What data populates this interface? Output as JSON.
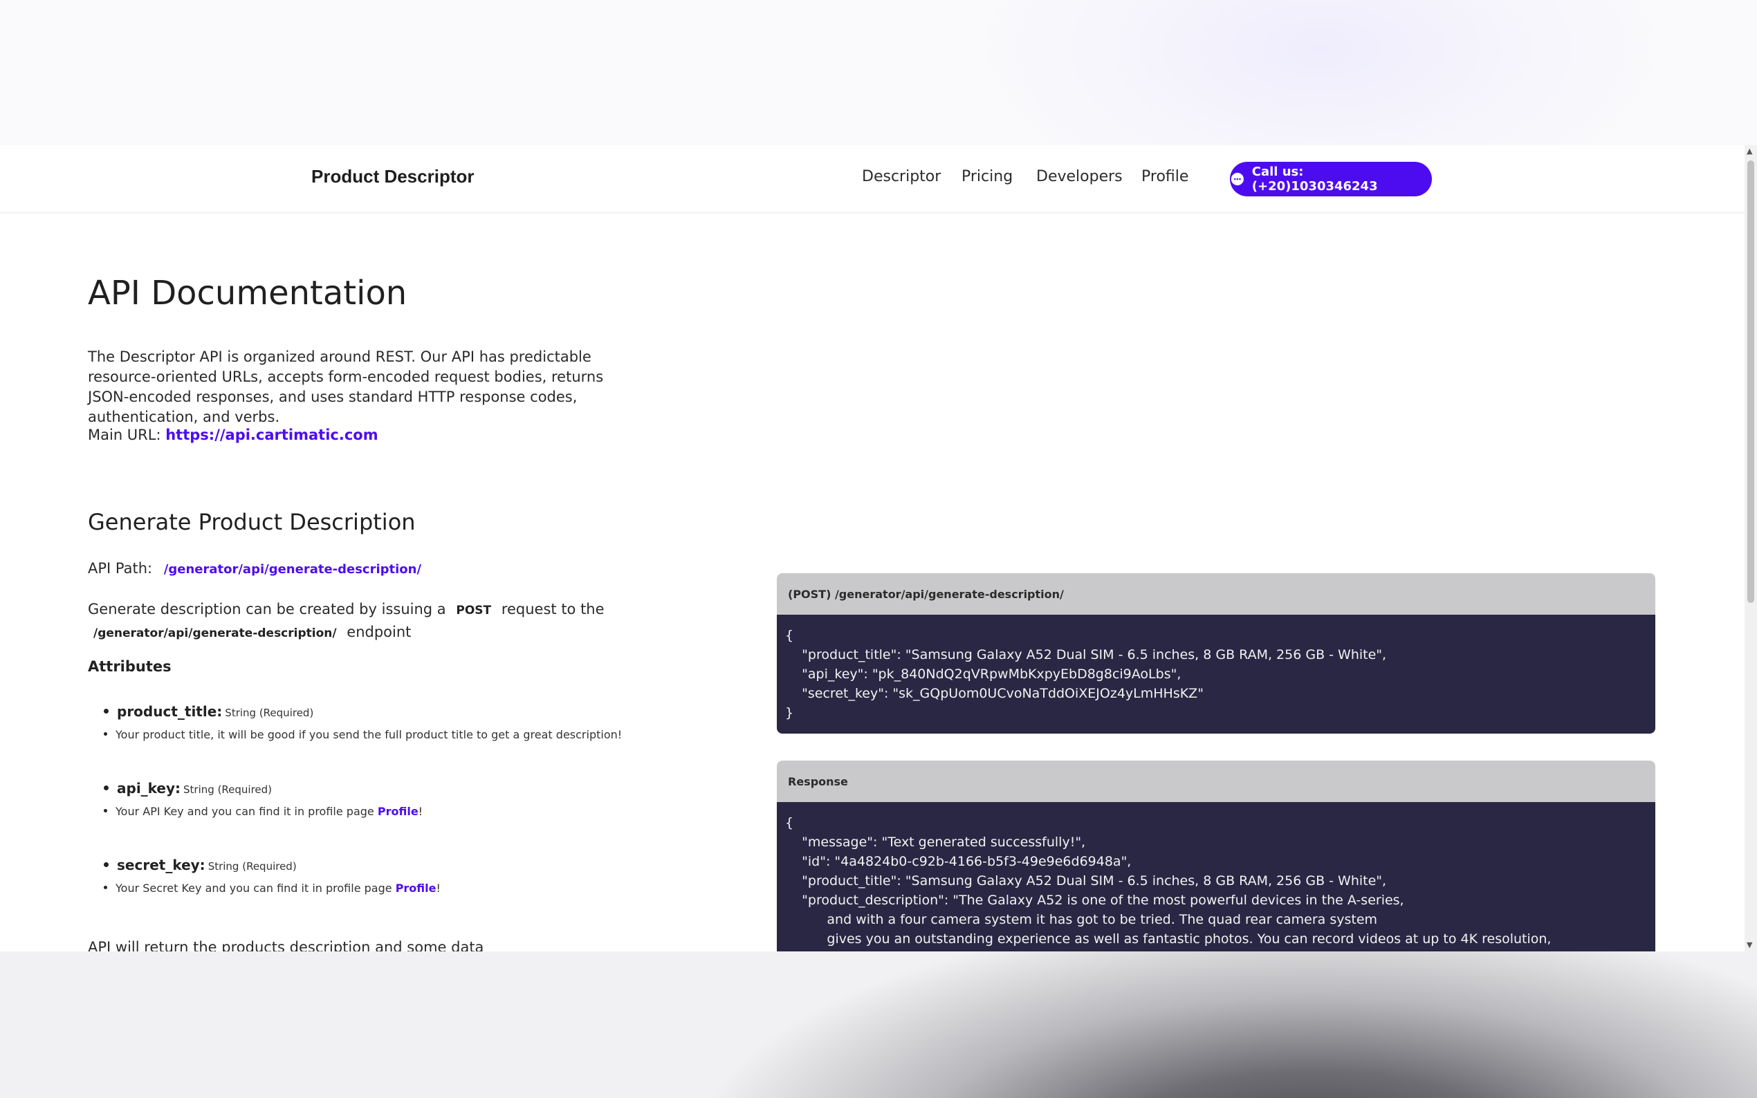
{
  "navbar": {
    "brand": "Product Descriptor",
    "links": [
      "Descriptor",
      "Pricing",
      "Developers",
      "Profile"
    ],
    "call_button": "Call us: (+20)1030346243"
  },
  "page": {
    "title": "API Documentation",
    "intro": "The Descriptor API is organized around REST. Our API has predictable resource-oriented URLs, accepts form-encoded request bodies, returns JSON-encoded responses, and uses standard HTTP response codes, authentication, and verbs.",
    "main_url_label": "Main URL:",
    "main_url": "https://api.cartimatic.com"
  },
  "section": {
    "title": "Generate Product Description",
    "api_path_label": "API Path:",
    "api_path": "/generator/api/generate-description/",
    "desc_part1": "Generate description can be created by issuing a",
    "desc_method": "POST",
    "desc_part2": "request to the",
    "desc_endpoint": "/generator/api/generate-description/",
    "desc_part3": "endpoint",
    "attributes_title": "Attributes",
    "attributes": [
      {
        "name": "product_title:",
        "type": "String (Required)",
        "note": "Your product title, it will be good if you send the full product title to get a great description!",
        "note_link": "",
        "note_tail": ""
      },
      {
        "name": "api_key:",
        "type": "String (Required)",
        "note": "Your API Key and you can find it in profile page",
        "note_link": "Profile",
        "note_tail": "!"
      },
      {
        "name": "secret_key:",
        "type": "String (Required)",
        "note": "Your Secret Key and you can find it in profile page",
        "note_link": "Profile",
        "note_tail": "!"
      }
    ],
    "return_text": "API will return the products description and some data"
  },
  "request_panel": {
    "header": "(POST) /generator/api/generate-description/",
    "lines": [
      "{",
      "    \"product_title\": \"Samsung Galaxy A52 Dual SIM - 6.5 inches, 8 GB RAM, 256 GB - White\",",
      "    \"api_key\": \"pk_840NdQ2qVRpwMbKxpyEbD8g8ci9AoLbs\",",
      "    \"secret_key\": \"sk_GQpUom0UCvoNaTddOiXEJOz4yLmHHsKZ\"",
      "}"
    ]
  },
  "response_panel": {
    "header": "Response",
    "lines": [
      "{",
      "    \"message\": \"Text generated successfully!\",",
      "    \"id\": \"4a4824b0-c92b-4166-b5f3-49e9e6d6948a\",",
      "    \"product_title\": \"Samsung Galaxy A52 Dual SIM - 6.5 inches, 8 GB RAM, 256 GB - White\",",
      "    \"product_description\": \"The Galaxy A52 is one of the most powerful devices in the A-series,",
      "          and with a four camera system it has got to be tried. The quad rear camera system",
      "          gives you an outstanding experience as well as fantastic photos. You can record videos at up to 4K resolution,"
    ]
  }
}
